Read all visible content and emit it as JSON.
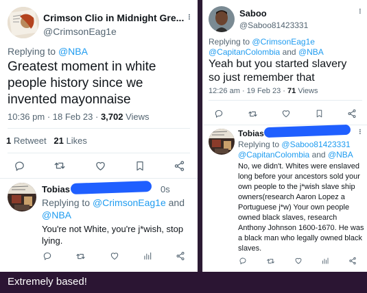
{
  "left": {
    "main_tweet": {
      "display_name": "Crimson Clio in Midnight Gre...",
      "handle": "@CrimsonEag1e",
      "replying_label": "Replying to",
      "replying_to": "@NBA",
      "text": "Greatest moment in white people history since we invented mayonnaise",
      "time": "10:36 pm",
      "dot": "·",
      "date": "18 Feb 23",
      "views_count": "3,702",
      "views_label": "Views",
      "retweets_count": "1",
      "retweets_label": "Retweet",
      "likes_count": "21",
      "likes_label": "Likes"
    },
    "reply": {
      "display_name": "Tobias",
      "age": "0s",
      "replying_label": "Replying to",
      "replying_to_1": "@CrimsonEag1e",
      "and": "and",
      "replying_to_2": "@NBA",
      "text": "You're not White, you're j*wish, stop lying."
    }
  },
  "right": {
    "main_tweet": {
      "display_name": "Saboo",
      "handle": "@Saboo81423331",
      "replying_label": "Replying to",
      "replying_to_1": "@CrimsonEag1e",
      "replying_to_2": "@CapitanColombia",
      "and": "and",
      "replying_to_3": "@NBA",
      "text": "Yeah but you started slavery so just remember that",
      "time": "12:26 am",
      "dot": "·",
      "date": "19 Feb 23",
      "views_count": "71",
      "views_label": "Views"
    },
    "reply": {
      "display_name": "Tobias",
      "replying_label": "Replying to",
      "replying_to_1": "@Saboo81423331",
      "replying_to_2": "@CapitanColombia",
      "and": "and",
      "replying_to_3": "@NBA",
      "text": "No, we didn't. Whites were enslaved long before your ancestors sold your own people to the j*wish slave ship owners(research Aaron Lopez a Portuguese j*w) Your own people owned black slaves, research Anthony Johnson 1600-1670. He was a black man who legally owned black slaves."
    }
  },
  "caption": "Extremely based!",
  "colors": {
    "link": "#1d9bf0",
    "redaction": "#1f5fff",
    "caption_bg": "#2b1533"
  },
  "icons": [
    "reply-icon",
    "retweet-icon",
    "like-icon",
    "bookmark-icon",
    "share-icon",
    "views-icon"
  ]
}
